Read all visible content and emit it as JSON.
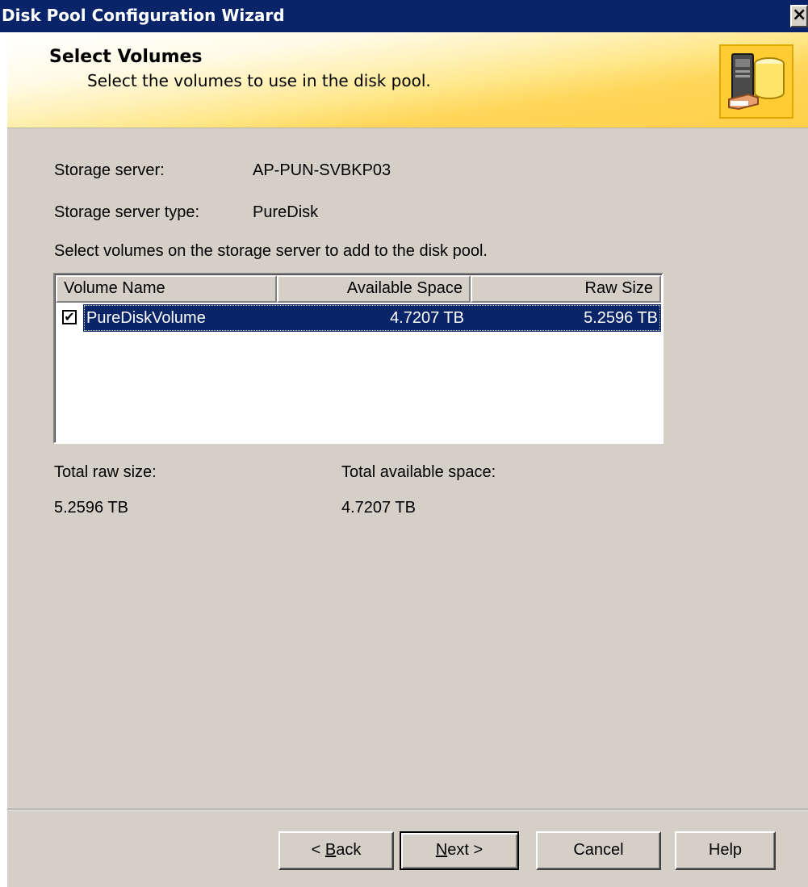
{
  "window": {
    "title": "Disk Pool Configuration Wizard",
    "close_glyph": "×"
  },
  "header": {
    "title": "Select Volumes",
    "subtitle": "Select the volumes to use in the disk pool.",
    "icon": "disk-pool-wizard-icon"
  },
  "info": {
    "storage_server_label": "Storage server:",
    "storage_server_value": "AP-PUN-SVBKP03",
    "storage_server_type_label": "Storage server type:",
    "storage_server_type_value": "PureDisk",
    "instruction": "Select volumes on the storage server to add to the disk pool."
  },
  "volumes": {
    "columns": [
      "Volume Name",
      "Available Space",
      "Raw Size"
    ],
    "rows": [
      {
        "checked": true,
        "check_glyph": "✔",
        "name": "PureDiskVolume",
        "available": "4.7207 TB",
        "raw": "5.2596 TB",
        "selected": true
      }
    ]
  },
  "totals": {
    "raw_label": "Total raw size:",
    "raw_value": "5.2596 TB",
    "available_label": "Total available space:",
    "available_value": "4.7207 TB"
  },
  "buttons": {
    "back_prefix": "< ",
    "back_accel": "B",
    "back_rest": "ack",
    "next_accel": "N",
    "next_rest": "ext >",
    "cancel": "Cancel",
    "help": "Help"
  },
  "colors": {
    "titlebar": "#0a246a",
    "selection": "#0a246a",
    "dialog_face": "#d4d0c8",
    "header_gold": "#ffcf48"
  }
}
